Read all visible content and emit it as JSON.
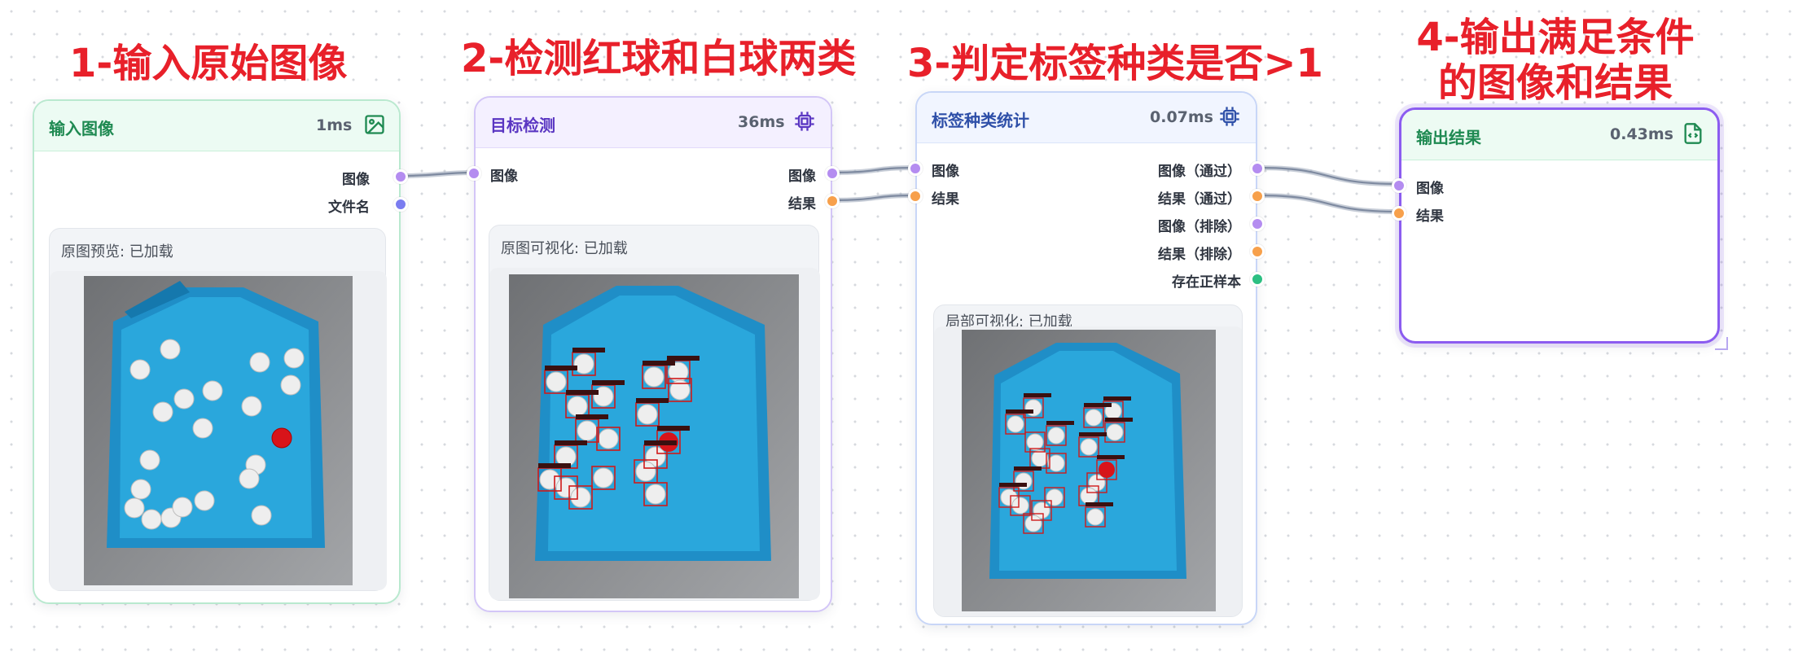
{
  "steps": {
    "step1": "1-输入原始图像",
    "step2": "2-检测红球和白球两类",
    "step3": "3-判定标签种类是否>1",
    "step4_line1": "4-输出满足条件",
    "step4_line2": "的图像和结果"
  },
  "nodes": {
    "input": {
      "title": "输入图像",
      "time": "1ms",
      "icon": "image-icon",
      "outputs": [
        "图像",
        "文件名"
      ],
      "preview_label": "原图预览: 已加载"
    },
    "detect": {
      "title": "目标检测",
      "time": "36ms",
      "icon": "chip-icon",
      "inputs": [
        "图像"
      ],
      "outputs": [
        "图像",
        "结果"
      ],
      "preview_label": "原图可视化: 已加载"
    },
    "stats": {
      "title": "标签种类统计",
      "time": "0.07ms",
      "icon": "chip-icon",
      "inputs": [
        "图像",
        "结果"
      ],
      "outputs": [
        "图像（通过）",
        "结果（通过）",
        "图像（排除）",
        "结果（排除）",
        "存在正样本"
      ],
      "preview_label": "局部可视化: 已加载"
    },
    "output": {
      "title": "输出结果",
      "time": "0.43ms",
      "icon": "file-code-icon",
      "inputs": [
        "图像",
        "结果"
      ]
    }
  },
  "colors": {
    "title_red": "#e8202a",
    "port_image": "#b48cf0",
    "port_result": "#f7a04b",
    "port_filename": "#7a7cf0",
    "port_positive": "#2cbf82",
    "input_border": "#b9e9cf",
    "input_header": "#ecfbf3",
    "input_title": "#1f8a52",
    "detect_border": "#d3c6f7",
    "detect_header": "#f4f0ff",
    "detect_title": "#5a36c2",
    "stats_border": "#c8d6f7",
    "stats_header": "#f1f5ff",
    "stats_title": "#2e4fa8",
    "output_border": "#8b5cf0",
    "output_header": "#edfbf3",
    "output_title": "#1f8a52"
  }
}
